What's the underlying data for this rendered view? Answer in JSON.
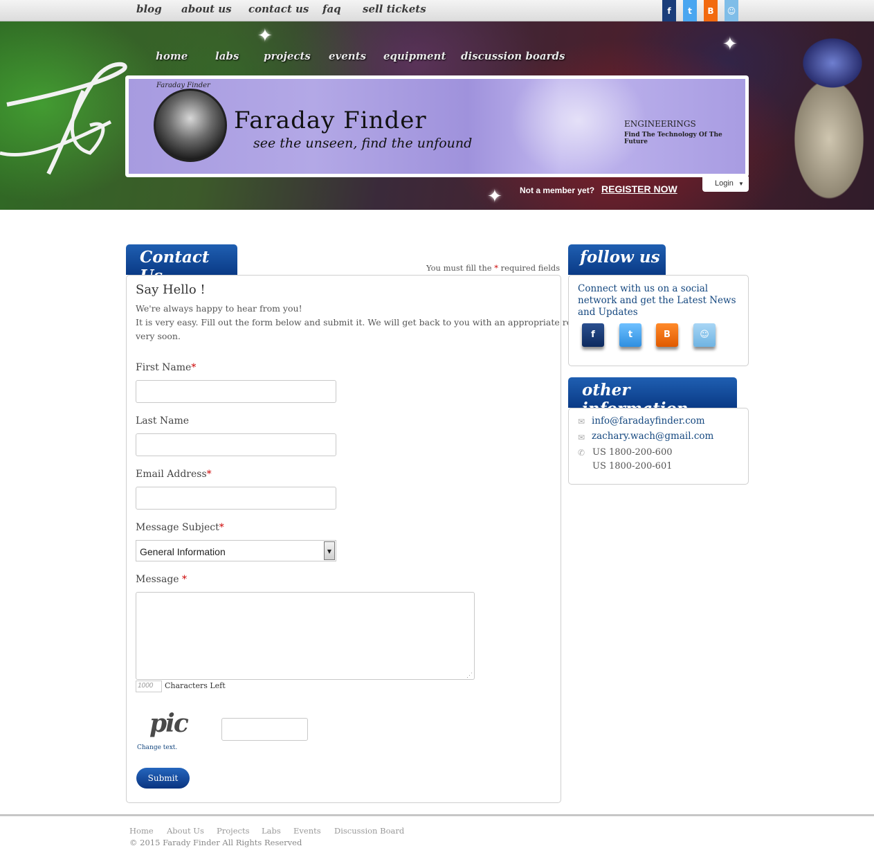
{
  "topnav": {
    "links": [
      "blog",
      "about us",
      "contact us",
      "faq",
      "sell tickets"
    ],
    "social_icons": [
      "facebook-icon",
      "twitter-icon",
      "blogger-icon",
      "reddit-icon"
    ]
  },
  "header": {
    "nav": [
      "home",
      "labs",
      "projects",
      "events",
      "equipment",
      "discussion boards"
    ],
    "logo_text": "Faraday Finder",
    "tagline": "see the unseen,  find the unfound",
    "engineering": "ENGINEERINGS",
    "engineering_sub": "Find The Technology Of The Future",
    "banner_arc_text": "Faraday Finder",
    "not_member": "Not a member yet?",
    "register": "REGISTER NOW",
    "login": "Login"
  },
  "contact": {
    "tab_title": "Contact Us",
    "required_note_pre": "You must fill the",
    "required_star": "*",
    "required_note_post": "required fields",
    "heading": "Say Hello !",
    "intro_1": "We're always happy to hear from you!",
    "intro_2": "It is very easy. Fill out the form below and submit it. We will get back to you with an appropriate reply",
    "intro_3": "very soon.",
    "first_name": "First Name",
    "last_name": "Last Name",
    "email": "Email Address",
    "subject_label": "Message Subject",
    "subject_value": "General Information",
    "message_label": "Message ",
    "chars_value": "1000",
    "chars_label": "Characters Left",
    "captcha_text": "pic",
    "change_text": "Change text.",
    "submit": "Submit"
  },
  "follow": {
    "tab_title": "follow us",
    "text": "Connect with us on a social network and get the Latest News and Updates",
    "icons": [
      "facebook-icon",
      "twitter-icon",
      "blogger-icon",
      "reddit-icon"
    ]
  },
  "other": {
    "tab_title": "other information",
    "email_1": "info@faradayfinder.com",
    "email_2": "zachary.wach@gmail.com",
    "phone_1": "US 1800-200-600",
    "phone_2": "US 1800-200-601"
  },
  "footer": {
    "links": [
      "Home",
      "About Us",
      "Projects",
      "Labs",
      "Events",
      "Discussion Board"
    ],
    "copyright": "© 2015 Farady Finder All Rights Reserved"
  },
  "colors": {
    "brand_blue": "#0a3a86",
    "link_blue": "#14477f",
    "facebook": "#1a3d7a",
    "twitter": "#4aa6f0",
    "blogger": "#f26a10",
    "reddit": "#7fbde8"
  }
}
